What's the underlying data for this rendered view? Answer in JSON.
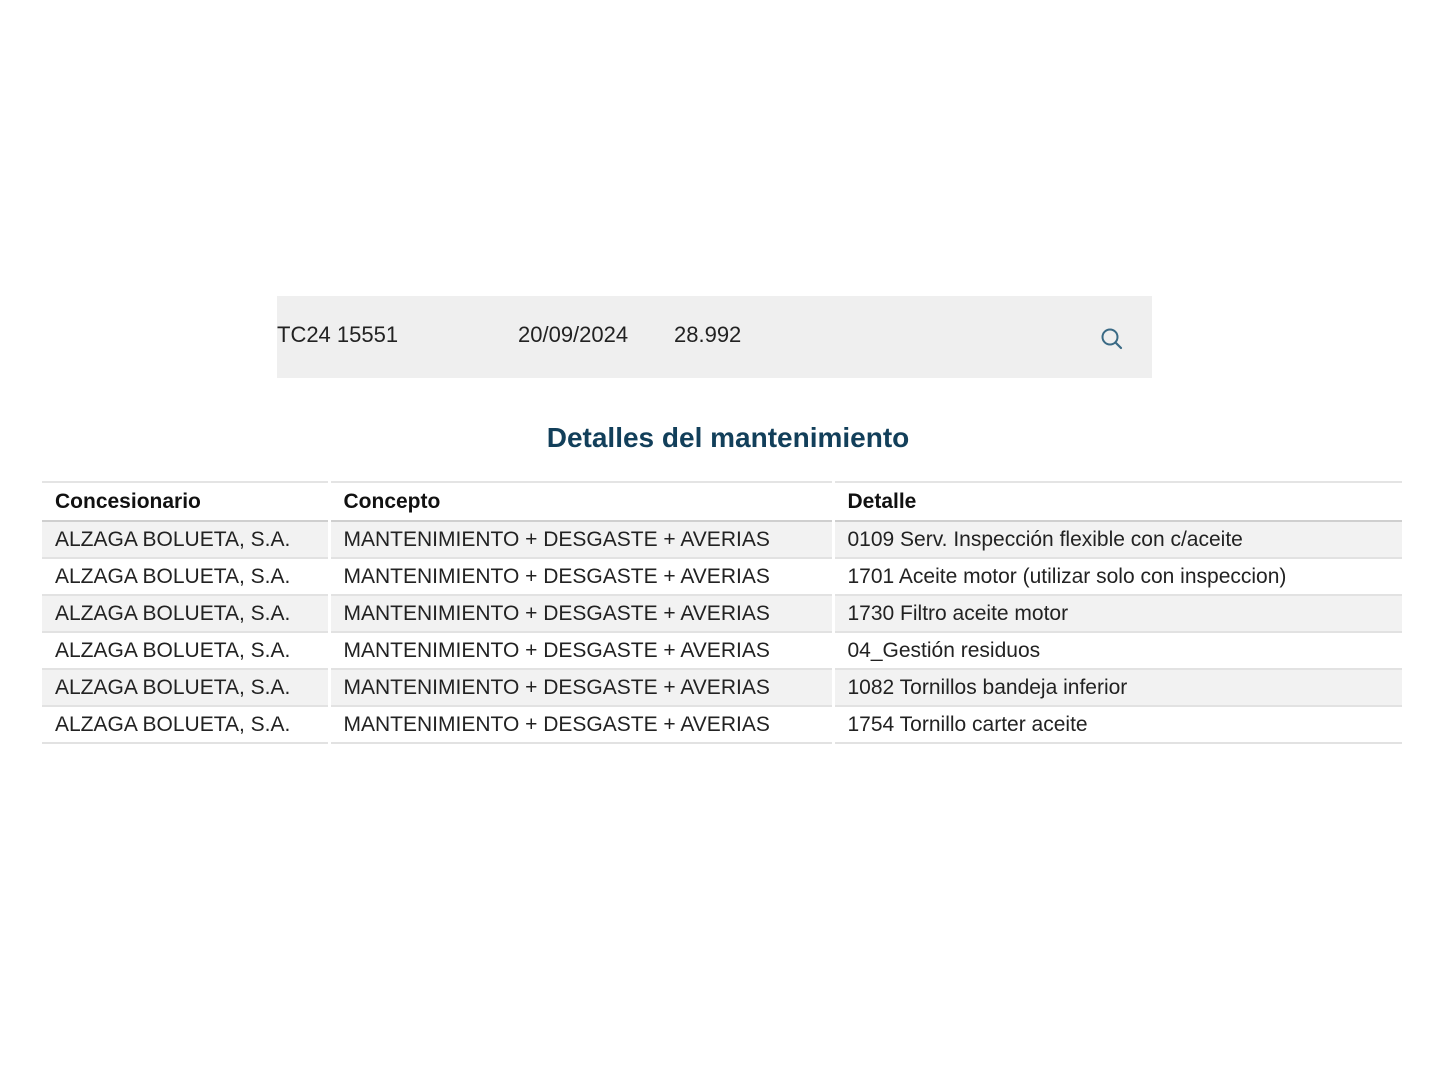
{
  "summary": {
    "plate": "TC24 15551",
    "date": "20/09/2024",
    "km": "28.992",
    "search_icon": "search-icon"
  },
  "section": {
    "title": "Detalles del mantenimiento"
  },
  "table": {
    "headers": [
      "Concesionario",
      "Concepto",
      "Detalle"
    ],
    "rows": [
      [
        "ALZAGA BOLUETA, S.A.",
        "MANTENIMIENTO + DESGASTE + AVERIAS",
        "0109 Serv. Inspección flexible con c/aceite"
      ],
      [
        "ALZAGA BOLUETA, S.A.",
        "MANTENIMIENTO + DESGASTE + AVERIAS",
        "1701 Aceite motor (utilizar solo con inspeccion)"
      ],
      [
        "ALZAGA BOLUETA, S.A.",
        "MANTENIMIENTO + DESGASTE + AVERIAS",
        "1730 Filtro aceite motor"
      ],
      [
        "ALZAGA BOLUETA, S.A.",
        "MANTENIMIENTO + DESGASTE + AVERIAS",
        "04_Gestión residuos"
      ],
      [
        "ALZAGA BOLUETA, S.A.",
        "MANTENIMIENTO + DESGASTE + AVERIAS",
        "1082 Tornillos bandeja inferior"
      ],
      [
        "ALZAGA BOLUETA, S.A.",
        "MANTENIMIENTO + DESGASTE + AVERIAS",
        "1754 Tornillo carter aceite"
      ]
    ]
  },
  "colors": {
    "title": "#123f5a",
    "icon": "#3a6a85",
    "summary_bg": "#efefef",
    "row_alt_bg": "#f2f2f2"
  }
}
